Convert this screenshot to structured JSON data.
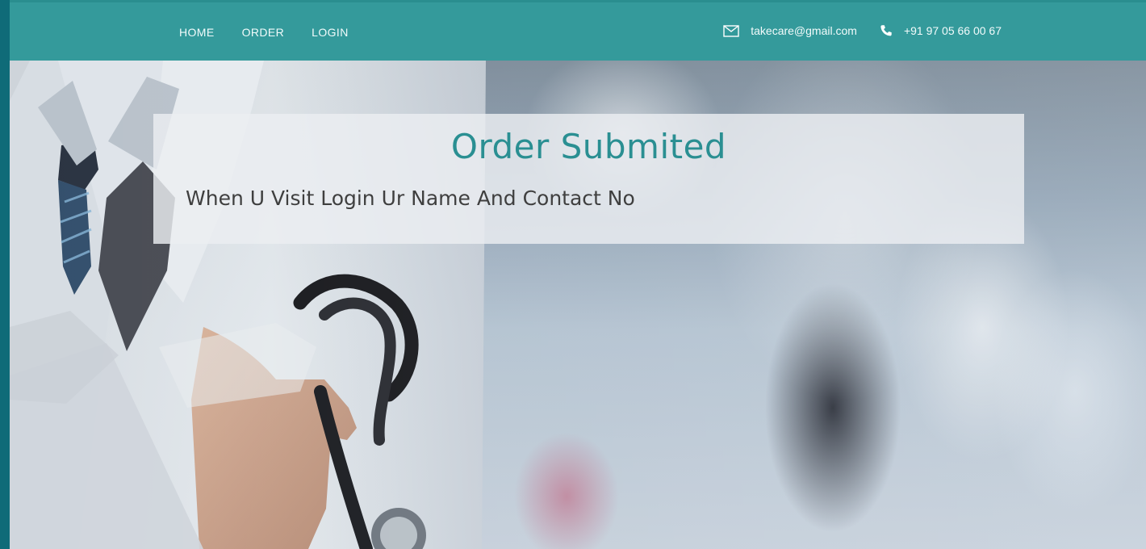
{
  "nav": {
    "items": [
      {
        "label": "HOME"
      },
      {
        "label": "ORDER"
      },
      {
        "label": "LOGIN"
      }
    ]
  },
  "contact": {
    "email": "takecare@gmail.com",
    "phone": "+91 97 05 66 00 67",
    "email_icon": "envelope-icon",
    "phone_icon": "phone-icon"
  },
  "notice": {
    "title": "Order Submited",
    "message": "When U Visit Login Ur Name And Contact No"
  },
  "colors": {
    "topbar": "#349a9b",
    "accent": "#2a8f92",
    "outer_frame": "#0f6b78"
  }
}
